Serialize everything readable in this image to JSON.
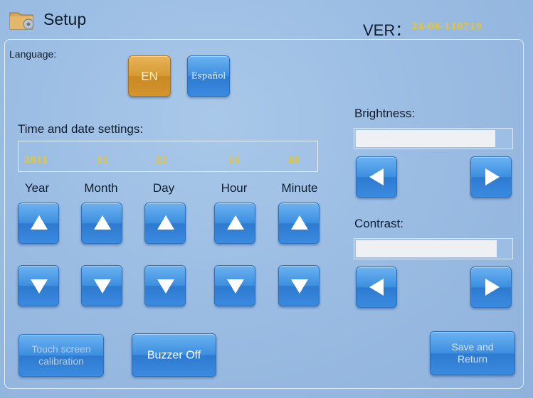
{
  "header": {
    "title": "Setup",
    "icon": "folder-gear-icon",
    "version_label": "VER：",
    "version_value": "24-08-110719"
  },
  "language": {
    "label": "Language:",
    "options": [
      "EN",
      "Español"
    ],
    "selected": "EN"
  },
  "datetime": {
    "label": "Time and date settings:",
    "fields": [
      {
        "name": "Year",
        "value": "2011"
      },
      {
        "name": "Month",
        "value": "11"
      },
      {
        "name": "Day",
        "value": "22"
      },
      {
        "name": "Hour",
        "value": "16"
      },
      {
        "name": "Minute",
        "value": "48"
      }
    ]
  },
  "brightness": {
    "label": "Brightness:",
    "level": 0.9
  },
  "contrast": {
    "label": "Contrast:",
    "level": 0.91
  },
  "footer": {
    "touch_calibration": "Touch screen calibration",
    "buzzer": "Buzzer Off",
    "save_return": "Save and Return"
  },
  "colors": {
    "accent_blue": "#3c8ee0",
    "selected_orange": "#d69a34",
    "value_yellow": "#e9c52b",
    "background": "#9bbde3"
  }
}
